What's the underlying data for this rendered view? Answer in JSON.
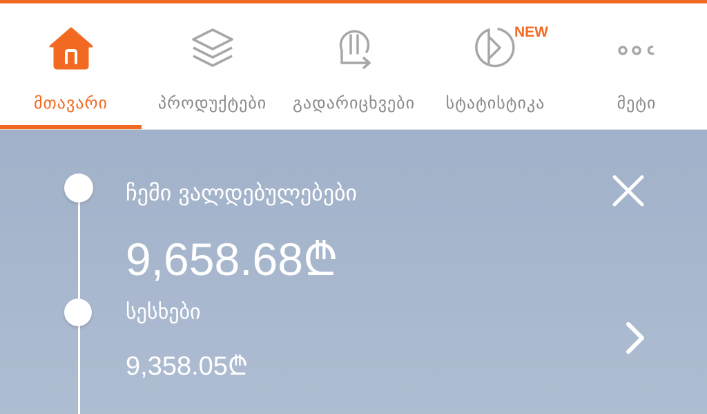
{
  "colors": {
    "accent": "#f26a21",
    "icon_gray": "#a7a7a7",
    "panel": "#a1b1c9"
  },
  "tabs": [
    {
      "label": "მთავარი",
      "icon": "home-icon",
      "active": true
    },
    {
      "label": "პროდუქტები",
      "icon": "layers-icon",
      "active": false
    },
    {
      "label": "გადარიცხვები",
      "icon": "lari-transfer-icon",
      "active": false
    },
    {
      "label": "სტატისტიკა",
      "icon": "statistics-icon",
      "active": false,
      "badge": "NEW"
    },
    {
      "label": "მეტი",
      "icon": "more-icon",
      "active": false
    }
  ],
  "obligations": {
    "title": "ჩემი ვალდებულებები",
    "total": "9,658.68₾",
    "loans_label": "სესხები",
    "loans_amount": "9,358.05₾"
  }
}
